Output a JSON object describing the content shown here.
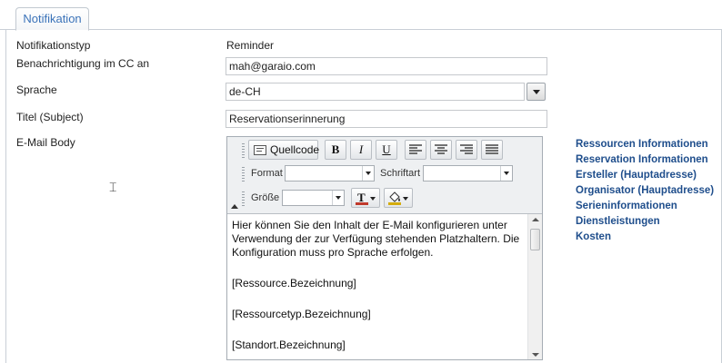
{
  "tabs": [
    {
      "label": "Notifikation",
      "active": true
    }
  ],
  "form": {
    "type_label": "Notifikationstyp",
    "type_value": "Reminder",
    "cc_label": "Benachrichtigung im CC an",
    "cc_value": "mah@garaio.com",
    "language_label": "Sprache",
    "language_value": "de-CH",
    "subject_label": "Titel (Subject)",
    "subject_value": "Reservationserinnerung",
    "body_label": "E-Mail Body"
  },
  "editor": {
    "source_button": "Quellcode",
    "bold": "B",
    "italic": "I",
    "underline": "U",
    "format_label": "Format",
    "font_label": "Schriftart",
    "size_label": "Größe",
    "text_color_glyph": "T",
    "content": [
      "Hier können Sie den Inhalt der E-Mail konfigurieren unter Verwendung der zur Verfügung stehenden Platzhaltern. Die Konfiguration muss pro Sprache erfolgen.",
      "[Ressource.Bezeichnung]",
      "[Ressourcetyp.Bezeichnung]",
      "[Standort.Bezeichnung]"
    ]
  },
  "placeholders": [
    "Ressourcen Informationen",
    "Reservation Informationen",
    "Ersteller (Hauptadresse)",
    "Organisator (Hauptadresse)",
    "Serieninformationen",
    "Dienstleistungen",
    "Kosten"
  ],
  "colors": {
    "accent": "#3b73b9",
    "link": "#1f4e8c",
    "border": "#c9cfd6"
  },
  "icons": [
    "source-icon",
    "align-left-icon",
    "align-center-icon",
    "align-right-icon",
    "align-justify-icon",
    "text-color-icon",
    "background-color-icon",
    "text-cursor-icon"
  ]
}
